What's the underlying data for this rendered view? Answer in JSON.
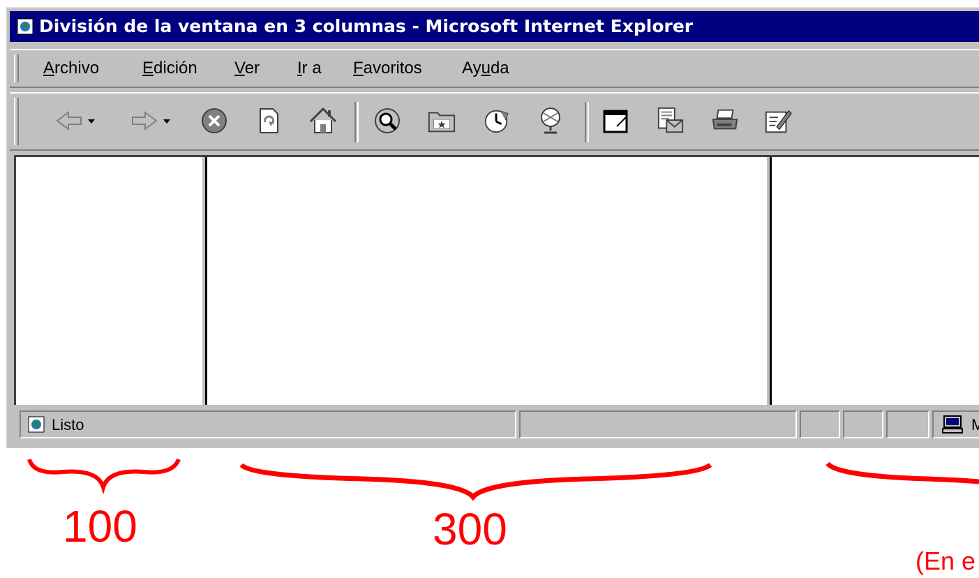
{
  "window": {
    "title": "División de la ventana en 3 columnas - Microsoft Internet Explorer"
  },
  "menu": {
    "items": [
      {
        "accel": "A",
        "rest": "rchivo"
      },
      {
        "accel": "E",
        "rest": "dición"
      },
      {
        "accel": "V",
        "rest": "er"
      },
      {
        "accel": "I",
        "rest": "r a"
      },
      {
        "accel": "F",
        "rest": "avoritos"
      },
      {
        "pre": "Ay",
        "accel": "u",
        "rest": "da"
      }
    ]
  },
  "toolbar": {
    "buttons": [
      "back-icon",
      "forward-icon",
      "stop-icon",
      "refresh-icon",
      "home-icon",
      "search-icon",
      "favorites-icon",
      "history-icon",
      "channels-icon",
      "fullscreen-icon",
      "mail-icon",
      "print-icon",
      "edit-icon"
    ]
  },
  "status": {
    "text": "Listo",
    "zone": "M"
  },
  "annotations": {
    "left_width": "100",
    "middle_width": "300",
    "note": "(En e"
  },
  "colors": {
    "titlebar": "#000080",
    "chrome": "#c0c0c0",
    "annotation": "#ff0000"
  }
}
